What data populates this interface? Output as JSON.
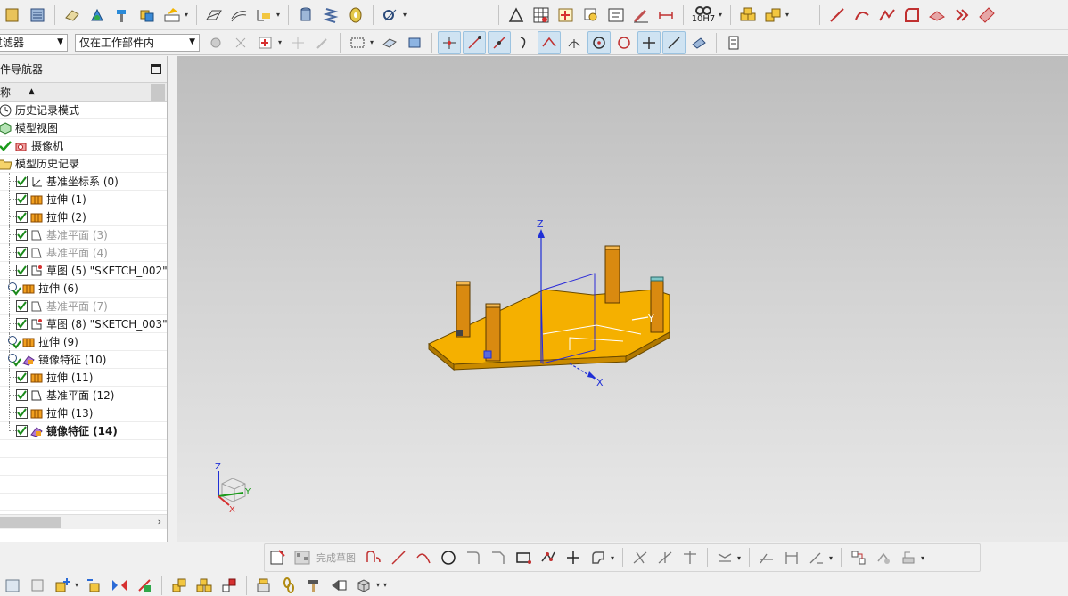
{
  "selection_bar": {
    "filter_label": "过滤器",
    "scope_label": "仅在工作部件内"
  },
  "navigator": {
    "title": "部件导航器",
    "column_name": "名称",
    "items": [
      {
        "label": "历史记录模式",
        "icon": "clock-icon"
      },
      {
        "label": "模型视图",
        "icon": "model-view-icon"
      },
      {
        "label": "摄像机",
        "icon": "camera-icon"
      },
      {
        "label": "模型历史记录",
        "icon": "folder-open-icon"
      },
      {
        "label": "基准坐标系 (0)",
        "icon": "datum-csys-icon"
      },
      {
        "label": "拉伸 (1)",
        "icon": "extrude-icon"
      },
      {
        "label": "拉伸 (2)",
        "icon": "extrude-icon"
      },
      {
        "label": "基准平面 (3)",
        "icon": "datum-plane-icon"
      },
      {
        "label": "基准平面 (4)",
        "icon": "datum-plane-icon"
      },
      {
        "label": "草图 (5) \"SKETCH_002\"",
        "icon": "sketch-icon"
      },
      {
        "label": "拉伸 (6)",
        "icon": "extrude-icon"
      },
      {
        "label": "基准平面 (7)",
        "icon": "datum-plane-icon"
      },
      {
        "label": "草图 (8) \"SKETCH_003\"",
        "icon": "sketch-icon"
      },
      {
        "label": "拉伸 (9)",
        "icon": "extrude-icon"
      },
      {
        "label": "镜像特征 (10)",
        "icon": "mirror-feature-icon"
      },
      {
        "label": "拉伸 (11)",
        "icon": "extrude-icon"
      },
      {
        "label": "基准平面 (12)",
        "icon": "datum-plane-icon"
      },
      {
        "label": "拉伸 (13)",
        "icon": "extrude-icon"
      },
      {
        "label": "镜像特征 (14)",
        "icon": "mirror-feature-icon"
      }
    ]
  },
  "viewport": {
    "axis_z": "Z",
    "axis_y": "Y",
    "axis_x": "X",
    "triad_z": "Z",
    "triad_y": "Y",
    "triad_x": "X"
  },
  "sketch_toolbar": {
    "finish_label": "完成草图"
  },
  "toolbar": {
    "tolerance_label": "10H7"
  },
  "colors": {
    "part_fill": "#f5b000",
    "part_edge": "#6a4a00",
    "post_fill": "#d98a10",
    "axis_blue": "#1f2fd6",
    "highlight": "#cfe3f2"
  }
}
